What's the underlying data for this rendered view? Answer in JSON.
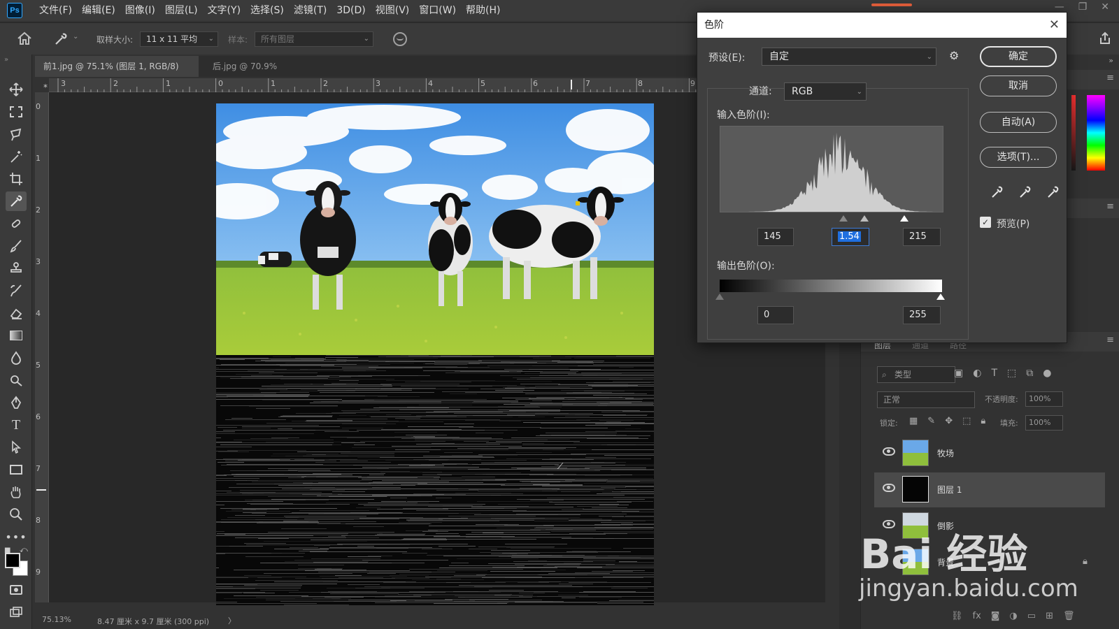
{
  "app": {
    "logo": "Ps",
    "menu": [
      "文件(F)",
      "编辑(E)",
      "图像(I)",
      "图层(L)",
      "文字(Y)",
      "选择(S)",
      "滤镜(T)",
      "3D(D)",
      "视图(V)",
      "窗口(W)",
      "帮助(H)"
    ],
    "window_controls": [
      "—",
      "❐",
      "✕"
    ]
  },
  "options_bar": {
    "sample_size_label": "取样大小:",
    "sample_size_value": "11 x 11 平均",
    "sample_label": "样本:",
    "sample_value": "所有图层"
  },
  "tabs": [
    {
      "label": "前1.jpg @ 75.1% (图层 1, RGB/8) *",
      "active": true
    },
    {
      "label": "后.jpg @ 70.9%(RGB/8)",
      "active": false
    }
  ],
  "rulers": {
    "h": [
      "3",
      "2",
      "1",
      "0",
      "1",
      "2",
      "3",
      "4",
      "5",
      "6",
      "7",
      "8",
      "9"
    ],
    "v": [
      "0",
      "1",
      "2",
      "3",
      "4",
      "5",
      "6",
      "7",
      "8",
      "9"
    ]
  },
  "status": {
    "zoom": "75.13%",
    "doc_size": "8.47 厘米 x 9.7 厘米 (300 ppi)",
    "arrow": "〉"
  },
  "levels_dialog": {
    "title": "色阶",
    "preset_label": "预设(E):",
    "preset_value": "自定",
    "channel_label": "通道:",
    "channel_value": "RGB",
    "input_label": "输入色阶(I):",
    "input_values": [
      "145",
      "1.54",
      "215"
    ],
    "output_label": "输出色阶(O):",
    "output_values": [
      "0",
      "255"
    ],
    "buttons": {
      "ok": "确定",
      "cancel": "取消",
      "auto": "自动(A)",
      "options": "选项(T)..."
    },
    "preview_label": "预览(P)",
    "preview_checked": true
  },
  "layers_panel": {
    "tabs": [
      "图层",
      "通道",
      "路径"
    ],
    "filter_label": "类型",
    "blend_mode": "正常",
    "opacity_label": "不透明度:",
    "opacity_value": "100%",
    "lock_label": "锁定:",
    "fill_label": "填充:",
    "fill_value": "100%",
    "layers": [
      {
        "name": "牧场",
        "selected": false
      },
      {
        "name": "图层 1",
        "selected": true
      },
      {
        "name": "倒影",
        "selected": false
      },
      {
        "name": "背景",
        "selected": false
      }
    ]
  },
  "watermark": {
    "logo": "Bai 经验",
    "url": "jingyan.baidu.com"
  }
}
